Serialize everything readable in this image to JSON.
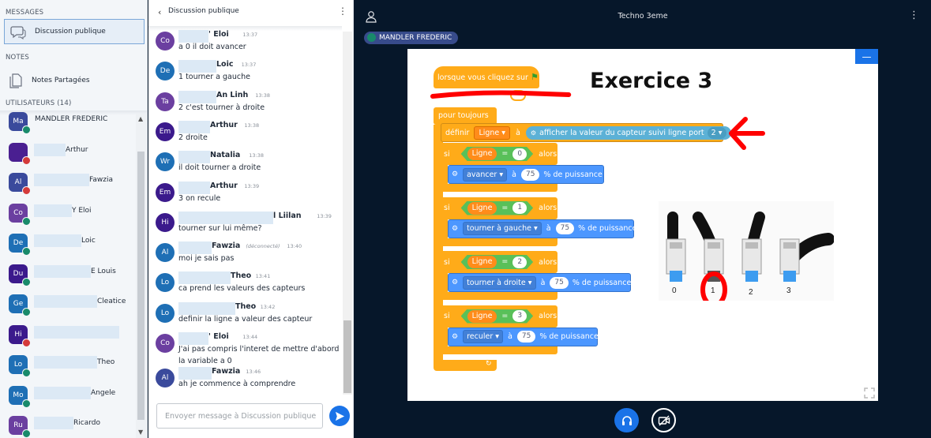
{
  "sidebar": {
    "messages_heading": "MESSAGES",
    "public_chat_label": "Discussion publique",
    "notes_heading": "NOTES",
    "notes_label": "Notes Partagées",
    "users_heading": "UTILISATEURS (14)",
    "users": [
      {
        "initials": "Ma",
        "name": "MANDLER FREDERIC",
        "color": "#3a4a9c",
        "status": "mic"
      },
      {
        "initials": "",
        "name": "Arthur",
        "color": "#4a1f91",
        "status": "muted"
      },
      {
        "initials": "Al",
        "name": "Fawzia",
        "color": "#3a4a9c",
        "status": "muted"
      },
      {
        "initials": "Co",
        "name": "Y Eloi",
        "color": "#6b3fa0",
        "status": "mic"
      },
      {
        "initials": "De",
        "name": "Loic",
        "color": "#1e6fb5",
        "status": "mic"
      },
      {
        "initials": "Du",
        "name": "E Louis",
        "color": "#3b1a8c",
        "status": "mic"
      },
      {
        "initials": "Ge",
        "name": "Cleatice",
        "color": "#1e6fb5",
        "status": "mic"
      },
      {
        "initials": "Hi",
        "name": "",
        "color": "#3b1a8c",
        "status": "muted"
      },
      {
        "initials": "Lo",
        "name": "Theo",
        "color": "#1e6fb5",
        "status": "mic"
      },
      {
        "initials": "Mo",
        "name": "Angele",
        "color": "#1e6fb5",
        "status": "mic"
      },
      {
        "initials": "Ru",
        "name": "Ricardo",
        "color": "#6b3fa0",
        "status": "mic"
      }
    ]
  },
  "chat": {
    "title": "Discussion publique",
    "input_placeholder": "Envoyer message à Discussion publique",
    "messages": [
      {
        "initials": "Co",
        "color": "#6b3fa0",
        "name": "' Eloi",
        "time": "13:37",
        "text": "a 0 il doit avancer"
      },
      {
        "initials": "De",
        "color": "#1e6fb5",
        "name": "Loic",
        "time": "13:37",
        "text": "1 tourner a gauche"
      },
      {
        "initials": "Ta",
        "color": "#6b3fa0",
        "name": "An Linh",
        "time": "13:38",
        "text": "2 c'est tourner à droite"
      },
      {
        "initials": "Em",
        "color": "#3b1a8c",
        "name": "Arthur",
        "time": "13:38",
        "text": "2 droite"
      },
      {
        "initials": "Wr",
        "color": "#1e6fb5",
        "name": "Natalia",
        "time": "13:38",
        "text": "il doit tourner a droite"
      },
      {
        "initials": "Em",
        "color": "#3b1a8c",
        "name": "Arthur",
        "time": "13:39",
        "text": "3 on recule"
      },
      {
        "initials": "Hi",
        "color": "#3b1a8c",
        "name": "l Liilan",
        "time": "13:39",
        "text": "tourner sur lui même?"
      },
      {
        "initials": "Al",
        "color": "#1e6fb5",
        "name": "Fawzia",
        "time": "13:40",
        "status": "(déconnecté)",
        "text": "moi je sais pas"
      },
      {
        "initials": "Lo",
        "color": "#1e6fb5",
        "name": "Theo",
        "time": "13:41",
        "text": "ca prend les valeurs des capteurs"
      },
      {
        "initials": "Lo",
        "color": "#1e6fb5",
        "name": "Theo",
        "time": "13:42",
        "text": "definir la ligne a valeur des capteur"
      },
      {
        "initials": "Co",
        "color": "#6b3fa0",
        "name": "' Eloi",
        "time": "13:44",
        "text": "J'ai pas compris l'interet de mettre d'abord la variable a 0"
      },
      {
        "initials": "Al",
        "color": "#3a4a9c",
        "name": "Fawzia",
        "time": "13:46",
        "text": "ah je commence à comprendre"
      }
    ]
  },
  "presentation": {
    "title": "Techno 3eme",
    "presenter": "MANDLER FREDERIC",
    "slide": {
      "heading": "Exercice 3",
      "hat_block": "lorsque vous cliquez sur",
      "forever_block": "pour toujours",
      "define_block": "définir",
      "variable": "Ligne",
      "to_word": "à",
      "sensor_block": "afficher la valeur du capteur suivi ligne port",
      "sensor_port": "2",
      "if_word": "si",
      "then_word": "alors",
      "equals": "=",
      "power_word": "% de puissance",
      "branches": [
        {
          "value": "0",
          "action": "avancer",
          "power": "75"
        },
        {
          "value": "1",
          "action": "tourner à gauche",
          "power": "75"
        },
        {
          "value": "2",
          "action": "tourner à droite",
          "power": "75"
        },
        {
          "value": "3",
          "action": "reculer",
          "power": "75"
        }
      ],
      "sensor_labels": [
        "0",
        "1",
        "2",
        "3"
      ]
    }
  }
}
